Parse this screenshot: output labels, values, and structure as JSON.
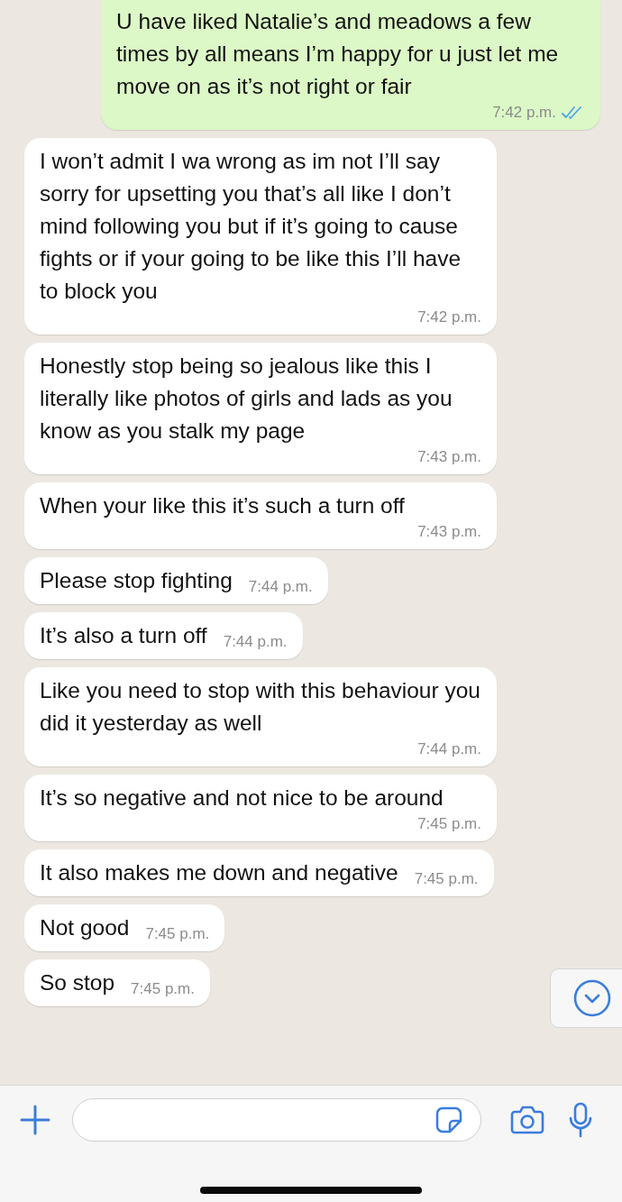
{
  "messages": [
    {
      "kind": "outgoing",
      "text": "U have liked Natalie’s and meadows a few times by all means I’m happy for u just let me move on as it’s not right or fair",
      "time": "7:42 p.m.",
      "read": true
    },
    {
      "kind": "incoming",
      "text": "I won’t admit I wa wrong as im not I’ll say sorry for upsetting you that’s all like I don’t mind following you but if it’s going to cause fights or if your going to be like this I’ll have to block you",
      "time": "7:42 p.m."
    },
    {
      "kind": "incoming",
      "text": "Honestly stop being so jealous like this I literally like photos of girls and lads as you know as you stalk my page",
      "time": "7:43 p.m."
    },
    {
      "kind": "incoming",
      "text": "When your like this it’s such a turn off",
      "time": "7:43 p.m."
    },
    {
      "kind": "incoming",
      "text": "Please stop fighting",
      "time": "7:44 p.m."
    },
    {
      "kind": "incoming",
      "text": "It’s also a turn off",
      "time": "7:44 p.m."
    },
    {
      "kind": "incoming",
      "text": "Like you need to stop with this behaviour you did it yesterday as well",
      "time": "7:44 p.m."
    },
    {
      "kind": "incoming",
      "text": "It’s so negative and not nice to be around",
      "time": "7:45 p.m."
    },
    {
      "kind": "incoming",
      "text": "It also makes me down and negative",
      "time": "7:45 p.m."
    },
    {
      "kind": "incoming",
      "text": "Not good",
      "time": "7:45 p.m."
    },
    {
      "kind": "incoming",
      "text": "So stop",
      "time": "7:45 p.m."
    }
  ]
}
